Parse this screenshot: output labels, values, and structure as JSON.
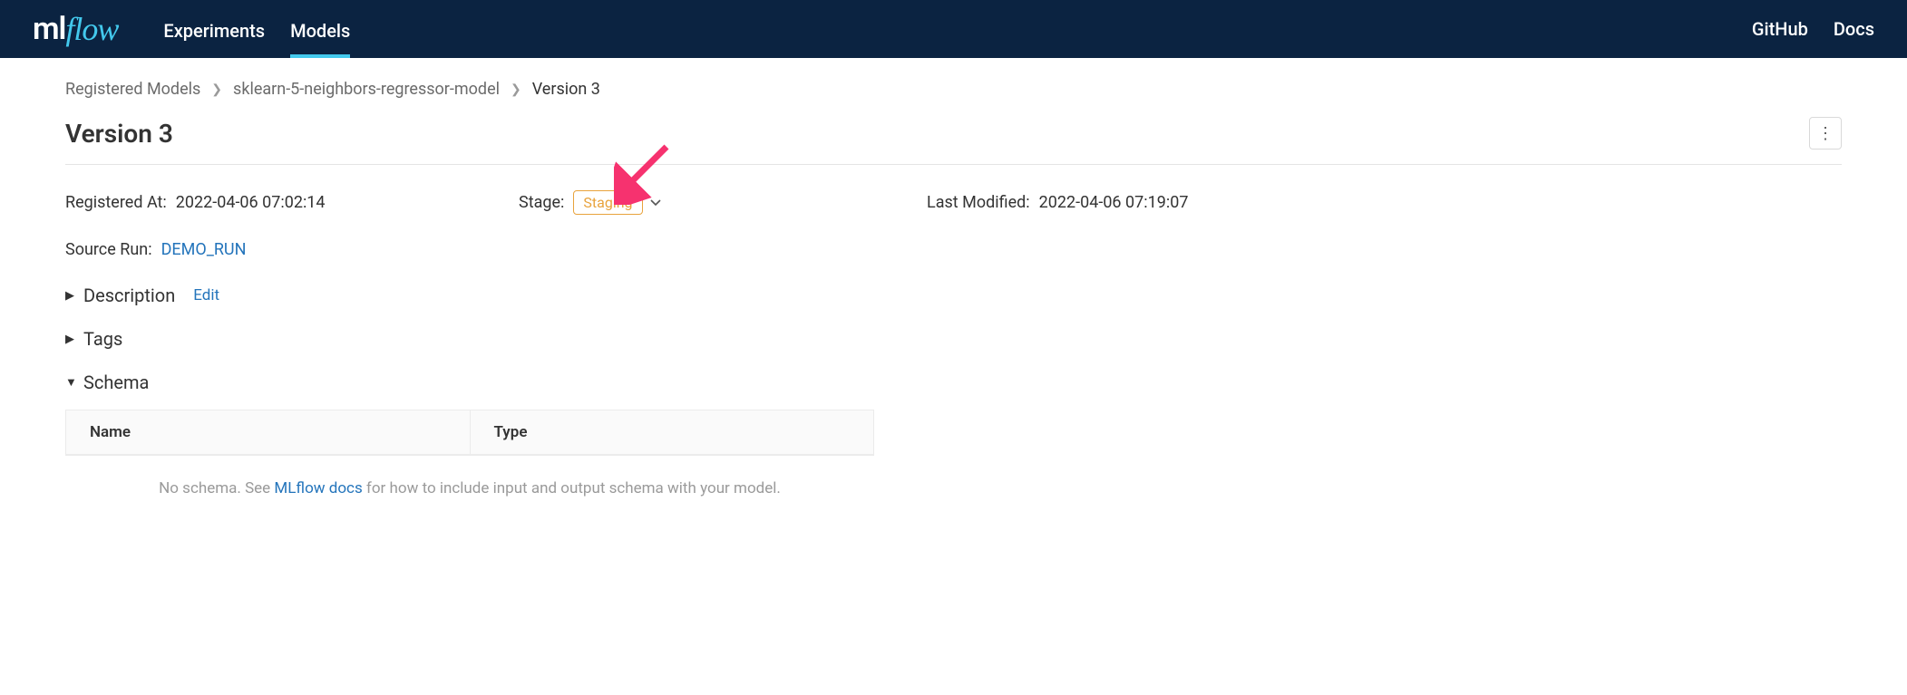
{
  "nav": {
    "experiments": "Experiments",
    "models": "Models",
    "github": "GitHub",
    "docs": "Docs"
  },
  "breadcrumb": {
    "root": "Registered Models",
    "model": "sklearn-5-neighbors-regressor-model",
    "version": "Version 3"
  },
  "page_title": "Version 3",
  "registered_at": {
    "label": "Registered At:",
    "value": "2022-04-06 07:02:14"
  },
  "stage": {
    "label": "Stage:",
    "value": "Staging"
  },
  "last_modified": {
    "label": "Last Modified:",
    "value": "2022-04-06 07:19:07"
  },
  "source_run": {
    "label": "Source Run:",
    "value": "DEMO_RUN"
  },
  "sections": {
    "description": "Description",
    "edit": "Edit",
    "tags": "Tags",
    "schema": "Schema"
  },
  "schema_table": {
    "col_name": "Name",
    "col_type": "Type",
    "empty_prefix": "No schema. See ",
    "empty_link": "MLflow docs",
    "empty_suffix": " for how to include input and output schema with your model."
  }
}
